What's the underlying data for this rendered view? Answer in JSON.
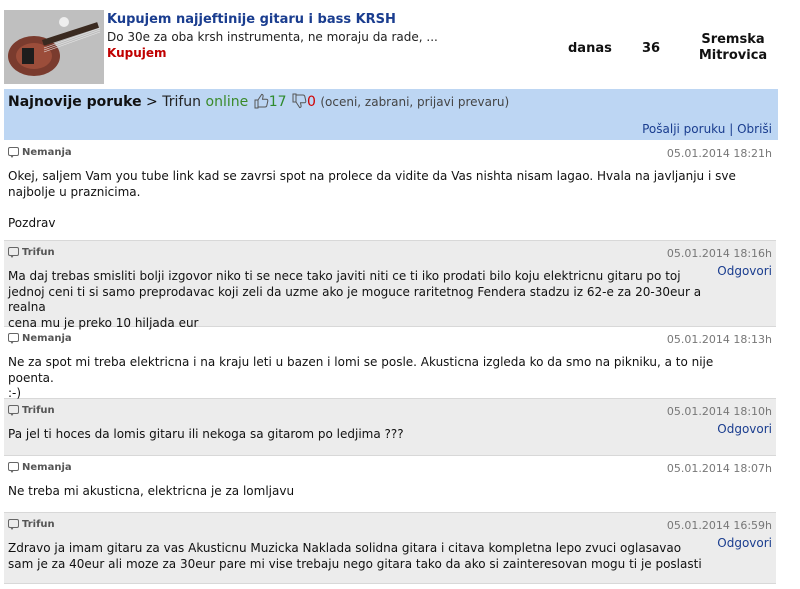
{
  "ad": {
    "title": "Kupujem najjeftinije gitaru i bass KRSH",
    "description": "Do 30e za oba krsh instrumenta, ne moraju da rade, ...",
    "type": "Kupujem",
    "date": "danas",
    "count": "36",
    "location_line1": "Sremska",
    "location_line2": "Mitrovica",
    "thumbnail_icon": "guitar-thumbnail"
  },
  "header": {
    "section": "Najnovije poruke",
    "arrow": ">",
    "user": "Trifun",
    "status": "online",
    "positive": "17",
    "negative": "0",
    "actions": "(oceni, zabrani, prijavi prevaru)",
    "send_link": "Pošalji poruku",
    "separator": "|",
    "delete_link": "Obriši",
    "colors": {
      "bar": "#bdd6f3",
      "online": "#3a8a2a",
      "positive": "#2e8b2e",
      "negative": "#d00000",
      "link": "#1a3d8f"
    }
  },
  "messages": [
    {
      "author": "Nemanja",
      "time": "05.01.2014 18:21h",
      "reply": "",
      "text_lines": [
        "Okej, saljem Vam you tube link kad se zavrsi spot na prolece da vidite da Vas nishta nisam lagao. Hvala na javljanju i sve",
        "najbolje u praznicima.",
        "",
        "Pozdrav"
      ]
    },
    {
      "author": "Trifun",
      "time": "05.01.2014 18:16h",
      "reply": "Odgovori",
      "text_lines": [
        "Ma daj trebas smisliti bolji izgovor niko ti se nece tako javiti niti ce ti iko prodati bilo koju elektricnu gitaru po toj",
        "jednoj ceni ti si samo preprodavac koji zeli da uzme ako je moguce raritetnog Fendera stadzu iz 62-e za 20-30eur a realna",
        "cena mu je preko 10 hiljada eur"
      ]
    },
    {
      "author": "Nemanja",
      "time": "05.01.2014 18:13h",
      "reply": "",
      "text_lines": [
        "Ne za spot mi treba elektricna i na kraju leti u bazen i lomi se posle. Akusticna izgleda ko da smo na pikniku, a to nije poenta.",
        ":-)"
      ]
    },
    {
      "author": "Trifun",
      "time": "05.01.2014 18:10h",
      "reply": "Odgovori",
      "text_lines": [
        "Pa jel ti hoces da lomis gitaru ili nekoga sa gitarom po ledjima ???"
      ]
    },
    {
      "author": "Nemanja",
      "time": "05.01.2014 18:07h",
      "reply": "",
      "text_lines": [
        "Ne treba mi akusticna, elektricna je za lomljavu"
      ]
    },
    {
      "author": "Trifun",
      "time": "05.01.2014 16:59h",
      "reply": "Odgovori",
      "text_lines": [
        "Zdravo ja imam gitaru za vas Akusticnu Muzicka Naklada solidna gitara i citava kompletna lepo zvuci oglasavao",
        "sam je za 40eur ali moze za 30eur pare mi vise trebaju nego gitara tako da ako si zainteresovan mogu ti je poslasti"
      ]
    }
  ]
}
